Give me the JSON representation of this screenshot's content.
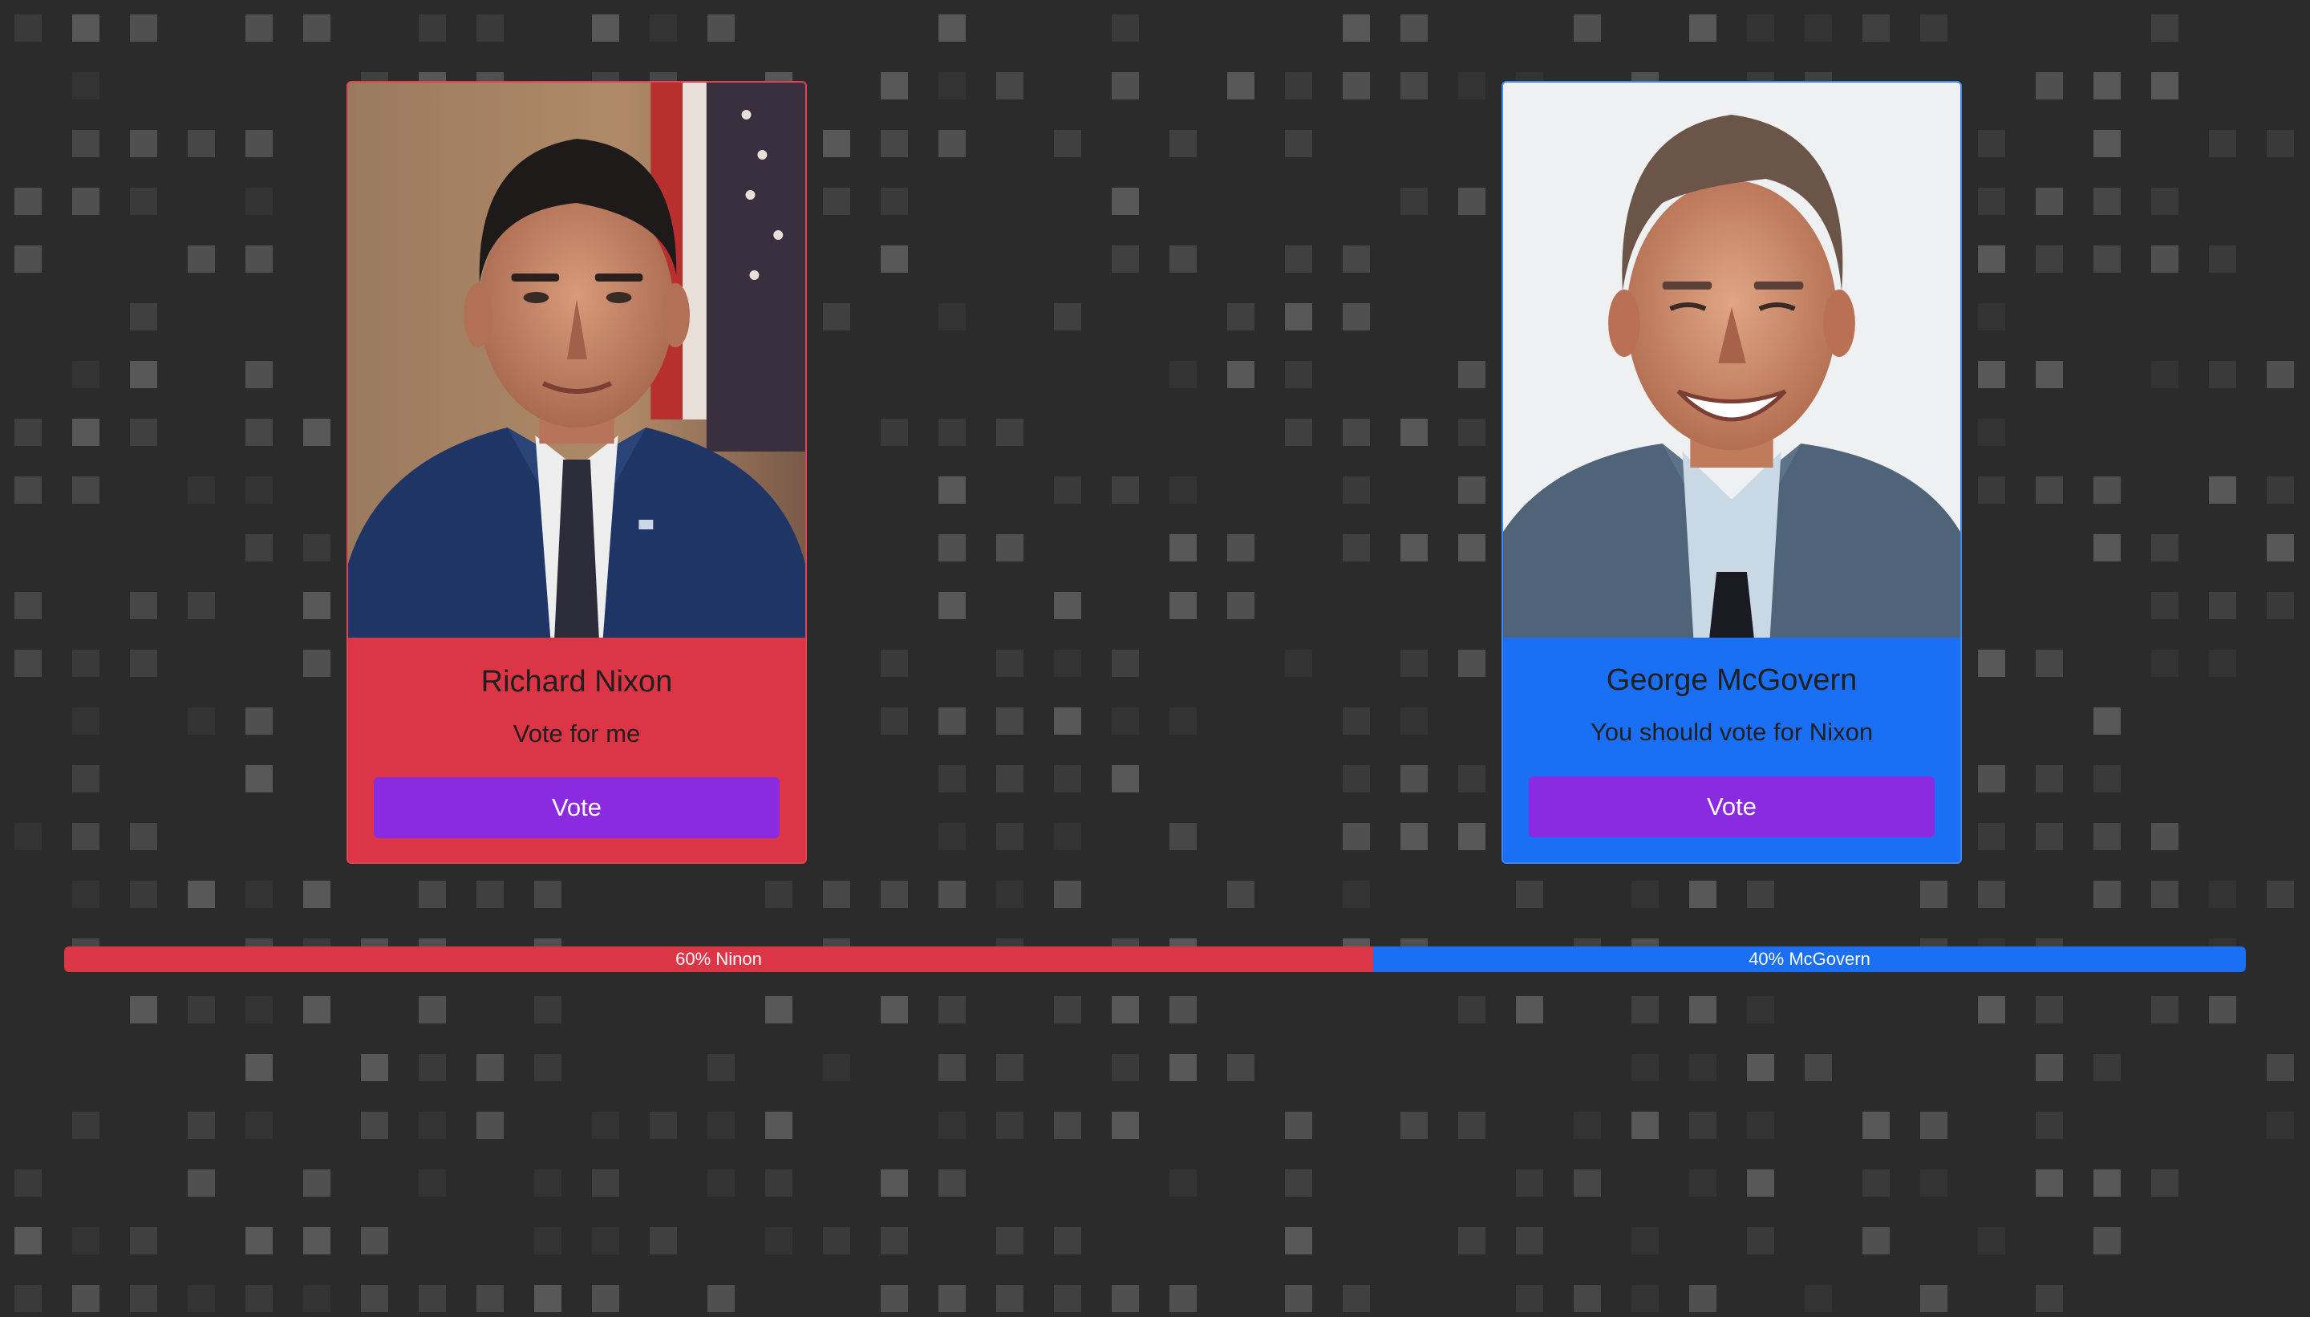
{
  "candidates": [
    {
      "name": "Richard Nixon",
      "slogan": "Vote for me",
      "vote_label": "Vote",
      "card_color": "#dc3545",
      "photo_icon": "candidate-portrait-image"
    },
    {
      "name": "George McGovern",
      "slogan": "You should vote for Nixon",
      "vote_label": "Vote",
      "card_color": "#1a6ff5",
      "photo_icon": "candidate-portrait-image"
    }
  ],
  "results": {
    "segments": [
      {
        "label": "60% Ninon",
        "percent": 60,
        "color": "#dc3545"
      },
      {
        "label": "40% McGovern",
        "percent": 40,
        "color": "#1a6ff5"
      }
    ]
  },
  "colors": {
    "background": "#2b2b2b",
    "vote_button": "#8a2be2"
  }
}
